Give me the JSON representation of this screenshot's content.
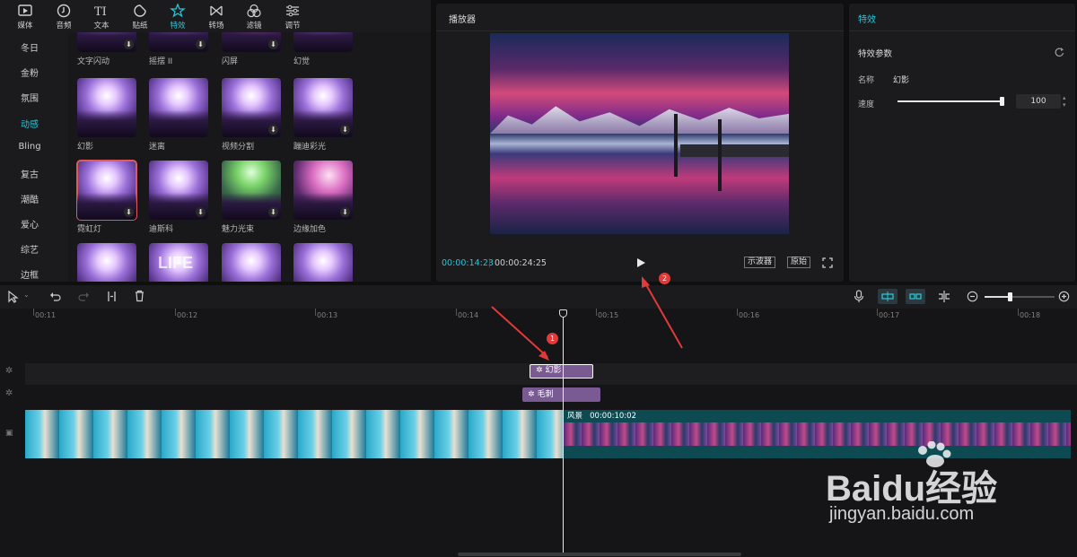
{
  "toolbar": {
    "tabs": [
      {
        "label": "媒体",
        "icon": "media-icon"
      },
      {
        "label": "音频",
        "icon": "audio-icon"
      },
      {
        "label": "文本",
        "icon": "text-icon"
      },
      {
        "label": "贴纸",
        "icon": "sticker-icon"
      },
      {
        "label": "特效",
        "icon": "effects-icon",
        "active": true
      },
      {
        "label": "转场",
        "icon": "transition-icon"
      },
      {
        "label": "滤镜",
        "icon": "filter-icon"
      },
      {
        "label": "调节",
        "icon": "adjust-icon"
      }
    ]
  },
  "categories": [
    "冬日",
    "金粉",
    "氛围",
    "动感",
    "Bling",
    "复古",
    "潮酷",
    "爱心",
    "综艺",
    "边框"
  ],
  "active_category": "动感",
  "effects": {
    "row0": [
      "文字闪动",
      "摇摆 II",
      "闪屏",
      "幻觉"
    ],
    "row1": [
      "幻影",
      "迷离",
      "视频分割",
      "蹦迪彩光"
    ],
    "row2": [
      "霓虹灯",
      "迪斯科",
      "魅力光束",
      "边缘加色"
    ],
    "row3_thumb_text": "LIFE"
  },
  "player": {
    "title": "播放器",
    "current_time": "00:00:14:23",
    "total_time": "00:00:24:25",
    "scope_button": "示波器",
    "original_button": "原始"
  },
  "params": {
    "title": "特效",
    "section": "特效参数",
    "name_label": "名称",
    "name_value": "幻影",
    "speed_label": "速度",
    "speed_value": "100",
    "speed_fraction": 0.98
  },
  "timeline": {
    "ticks": [
      "00:11",
      "00:12",
      "00:13",
      "00:14",
      "00:15",
      "00:16",
      "00:17",
      "00:18"
    ],
    "clip_effect1": "幻影",
    "clip_effect2": "毛刺",
    "video_clip_name": "风景",
    "video_clip_duration": "00:00:10:02",
    "zoom_fraction": 0.36
  },
  "callouts": [
    "1",
    "2"
  ],
  "watermark": {
    "brand": "Baidu经验",
    "url": "jingyan.baidu.com"
  },
  "colors": {
    "accent": "#29c4d8",
    "effect_clip": "#7a5a92",
    "callout": "#e03a3a"
  }
}
